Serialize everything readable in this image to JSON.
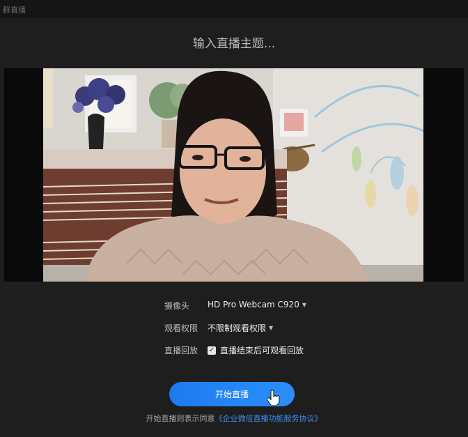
{
  "window": {
    "title": "群直播"
  },
  "topic": {
    "placeholder": "输入直播主题..."
  },
  "settings": {
    "camera": {
      "label": "摄像头",
      "value": "HD Pro Webcam C920"
    },
    "permission": {
      "label": "观看权限",
      "value": "不限制观看权限"
    },
    "replay": {
      "label": "直播回放",
      "checkbox_label": "直播结束后可观看回放",
      "checked": true
    }
  },
  "actions": {
    "start_label": "开始直播"
  },
  "agreement": {
    "prefix": "开始直播则表示同意",
    "link": "《企业微信直播功能服务协议》"
  },
  "icons": {
    "caret": "caret-down-icon",
    "check": "checkmark-icon",
    "cursor": "hand-pointer-icon"
  },
  "colors": {
    "background": "#1e1e1f",
    "accent": "#2b8ffb",
    "link": "#3d8ff2"
  }
}
